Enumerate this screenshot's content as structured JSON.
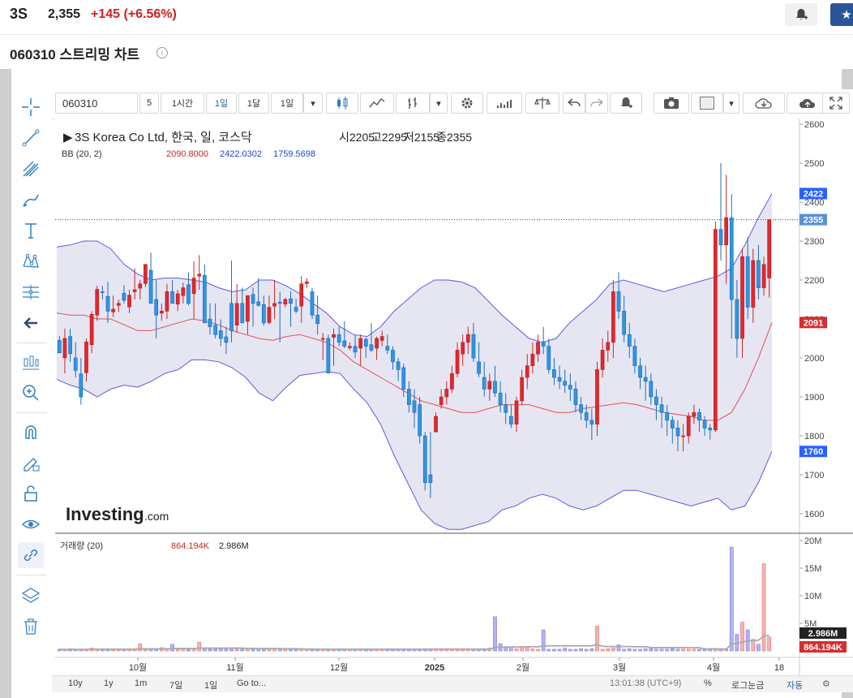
{
  "header": {
    "ticker": "3S",
    "price": "2,355",
    "change": "+145  (+6.56%)",
    "subtitle": "060310 스트리밍 차트"
  },
  "toolbar": {
    "symbol": "060310",
    "interval_num": "5",
    "interval_1h": "1시간",
    "interval_1d": "1일",
    "interval_1mo": "1달",
    "interval_dropdown": "1일"
  },
  "legend": {
    "main_title": "3S Korea Co Ltd, 한국, 일, 코스닥",
    "open": "시2205",
    "high": "고2295",
    "low": "저2155",
    "close": "종2355",
    "bb_label": "BB (20, 2)",
    "bb_mid": "2090.8000",
    "bb_upper": "2422.0302",
    "bb_lower": "1759.5698",
    "vol_label": "거래량 (20)",
    "vol_val1": "864.194K",
    "vol_val2": "2.986M"
  },
  "watermark": {
    "brand": "Investing",
    "suffix": ".com"
  },
  "chart_data": {
    "type": "candlestick",
    "price_axis": {
      "min": 1600,
      "max": 2600,
      "ticks": [
        1600,
        1700,
        1800,
        1900,
        2000,
        2100,
        2200,
        2300,
        2400,
        2500,
        2600
      ]
    },
    "price_badges": [
      {
        "label": "2422",
        "value": 2422,
        "color": "#2962ff"
      },
      {
        "label": "2355",
        "value": 2355,
        "color": "#5b8fd6"
      },
      {
        "label": "2091",
        "value": 2091,
        "color": "#d32f2f"
      },
      {
        "label": "1760",
        "value": 1760,
        "color": "#2962ff"
      }
    ],
    "volume_axis": {
      "min": 0,
      "max": 20000000,
      "tick_labels": [
        "5M",
        "10M",
        "15M",
        "20M"
      ]
    },
    "volume_badges": [
      {
        "label": "2.986M",
        "color": "#222"
      },
      {
        "label": "864.194K",
        "color": "#d32f2f"
      }
    ],
    "x_labels": [
      "10월",
      "11월",
      "12월",
      "2025",
      "2월",
      "3월",
      "4월",
      "18"
    ],
    "candles": [
      [
        2045,
        2056,
        2015,
        2013
      ],
      [
        2000,
        2075,
        1960,
        2050
      ],
      [
        2055,
        2075,
        1990,
        2011
      ],
      [
        2000,
        2040,
        1950,
        1968
      ],
      [
        1959,
        2000,
        1880,
        1900
      ],
      [
        1962,
        2050,
        1940,
        2041
      ],
      [
        2034,
        2120,
        2012,
        2112
      ],
      [
        2110,
        2185,
        2095,
        2176
      ],
      [
        2170,
        2185,
        2150,
        2168
      ],
      [
        2158,
        2196,
        2090,
        2120
      ],
      [
        2118,
        2160,
        2105,
        2125
      ],
      [
        2135,
        2150,
        2118,
        2140
      ],
      [
        2166,
        2187,
        2140,
        2148
      ],
      [
        2131,
        2175,
        2115,
        2161
      ],
      [
        2170,
        2230,
        2150,
        2175
      ],
      [
        2179,
        2200,
        2150,
        2190
      ],
      [
        2191,
        2241,
        2182,
        2240
      ],
      [
        2225,
        2270,
        2160,
        2140
      ],
      [
        2150,
        2200,
        2050,
        2110
      ],
      [
        2115,
        2140,
        2095,
        2120
      ],
      [
        2120,
        2190,
        2100,
        2170
      ],
      [
        2170,
        2200,
        2150,
        2140
      ],
      [
        2138,
        2175,
        2120,
        2165
      ],
      [
        2160,
        2193,
        2140,
        2180
      ],
      [
        2188,
        2220,
        2135,
        2140
      ],
      [
        2165,
        2248,
        2100,
        2205
      ],
      [
        2210,
        2264,
        2175,
        2215
      ],
      [
        2212,
        2240,
        2095,
        2090
      ],
      [
        2100,
        2140,
        2060,
        2080
      ],
      [
        2084,
        2140,
        2050,
        2060
      ],
      [
        2070,
        2099,
        2030,
        2050
      ],
      [
        2054,
        2080,
        2010,
        2040
      ],
      [
        2140,
        2250,
        2040,
        2070
      ],
      [
        2084,
        2190,
        2065,
        2140
      ],
      [
        2140,
        2180,
        2090,
        2090
      ],
      [
        2094,
        2160,
        2060,
        2160
      ],
      [
        2163,
        2181,
        2080,
        2140
      ],
      [
        2144,
        2205,
        2132,
        2135
      ],
      [
        2137,
        2160,
        2083,
        2090
      ],
      [
        2091,
        2160,
        2086,
        2130
      ],
      [
        2133,
        2200,
        2100,
        2140
      ],
      [
        2143,
        2170,
        2040,
        2140
      ],
      [
        2138,
        2155,
        2130,
        2150
      ],
      [
        2152,
        2171,
        2080,
        2140
      ],
      [
        2130,
        2152,
        2115,
        2120
      ],
      [
        2133,
        2210,
        2090,
        2190
      ],
      [
        2191,
        2205,
        2180,
        2195
      ],
      [
        2170,
        2180,
        2100,
        2110
      ],
      [
        2110,
        2160,
        2060,
        2088
      ],
      [
        2050,
        2064,
        1995,
        2050
      ],
      [
        2050,
        2060,
        1960,
        1961
      ],
      [
        2053,
        2075,
        1980,
        2060
      ],
      [
        2060,
        2080,
        2030,
        2040
      ],
      [
        2044,
        2094,
        2025,
        2030
      ],
      [
        2026,
        2040,
        2020,
        2030
      ],
      [
        2030,
        2060,
        2000,
        2015
      ],
      [
        2025,
        2060,
        1980,
        2050
      ],
      [
        2048,
        2052,
        2000,
        2030
      ],
      [
        2034,
        2089,
        2015,
        2020
      ],
      [
        2025,
        2055,
        1995,
        2050
      ],
      [
        2045,
        2070,
        2030,
        2055
      ],
      [
        2030,
        2060,
        2010,
        2020
      ],
      [
        2020,
        2030,
        1970,
        1990
      ],
      [
        1990,
        2000,
        1940,
        1970
      ],
      [
        1975,
        1985,
        1900,
        1920
      ],
      [
        1920,
        1940,
        1860,
        1880
      ],
      [
        1890,
        1920,
        1820,
        1860
      ],
      [
        1880,
        1900,
        1780,
        1800
      ],
      [
        1800,
        1810,
        1660,
        1680
      ],
      [
        1700,
        1810,
        1640,
        1680
      ],
      [
        1810,
        1860,
        1810,
        1850
      ],
      [
        1880,
        1920,
        1870,
        1900
      ],
      [
        1900,
        1940,
        1880,
        1920
      ],
      [
        1920,
        1980,
        1910,
        1960
      ],
      [
        1960,
        2040,
        1950,
        2020
      ],
      [
        2010,
        2060,
        1980,
        2040
      ],
      [
        2040,
        2080,
        2010,
        2060
      ],
      [
        2060,
        2090,
        1990,
        2000
      ],
      [
        1990,
        2040,
        1950,
        1960
      ],
      [
        1950,
        1990,
        1900,
        1920
      ],
      [
        1920,
        1960,
        1890,
        1940
      ],
      [
        1940,
        1980,
        1900,
        1910
      ],
      [
        1910,
        1940,
        1860,
        1880
      ],
      [
        1880,
        1910,
        1830,
        1860
      ],
      [
        1850,
        1880,
        1820,
        1830
      ],
      [
        1830,
        1900,
        1810,
        1890
      ],
      [
        1890,
        1970,
        1880,
        1950
      ],
      [
        1950,
        2010,
        1920,
        1980
      ],
      [
        1980,
        2040,
        1960,
        2010
      ],
      [
        2010,
        2060,
        1990,
        2040
      ],
      [
        2040,
        2080,
        2010,
        2030
      ],
      [
        2030,
        2050,
        1960,
        1970
      ],
      [
        1970,
        2000,
        1930,
        1950
      ],
      [
        1950,
        1980,
        1920,
        1940
      ],
      [
        1940,
        1970,
        1910,
        1930
      ],
      [
        1930,
        1960,
        1890,
        1920
      ],
      [
        1920,
        1940,
        1860,
        1880
      ],
      [
        1880,
        1900,
        1840,
        1860
      ],
      [
        1860,
        1880,
        1820,
        1840
      ],
      [
        1840,
        1870,
        1790,
        1830
      ],
      [
        1830,
        1990,
        1800,
        1970
      ],
      [
        1970,
        2050,
        1950,
        2020
      ],
      [
        2020,
        2070,
        1990,
        2040
      ],
      [
        2040,
        2200,
        2000,
        2170
      ],
      [
        2170,
        2220,
        2100,
        2120
      ],
      [
        2120,
        2160,
        2040,
        2060
      ],
      [
        2060,
        2090,
        2000,
        2030
      ],
      [
        2030,
        2050,
        1960,
        1980
      ],
      [
        1980,
        2000,
        1920,
        1950
      ],
      [
        1950,
        1980,
        1890,
        1940
      ],
      [
        1940,
        1960,
        1880,
        1900
      ],
      [
        1900,
        1920,
        1840,
        1880
      ],
      [
        1880,
        1900,
        1820,
        1860
      ],
      [
        1860,
        1880,
        1800,
        1840
      ],
      [
        1840,
        1850,
        1780,
        1820
      ],
      [
        1820,
        1840,
        1760,
        1800
      ],
      [
        1800,
        1830,
        1760,
        1800
      ],
      [
        1800,
        1860,
        1780,
        1850
      ],
      [
        1850,
        1880,
        1830,
        1860
      ],
      [
        1860,
        1870,
        1810,
        1840
      ],
      [
        1840,
        1850,
        1800,
        1820
      ],
      [
        1820,
        1830,
        1790,
        1815
      ],
      [
        1815,
        2350,
        1810,
        2330
      ],
      [
        2330,
        2500,
        2250,
        2290
      ],
      [
        2290,
        2470,
        2190,
        2360
      ],
      [
        2360,
        2420,
        2050,
        2150
      ],
      [
        2150,
        2200,
        2000,
        2050
      ],
      [
        2050,
        2280,
        2000,
        2260
      ],
      [
        2260,
        2310,
        2100,
        2130
      ],
      [
        2130,
        2280,
        2090,
        2250
      ],
      [
        2250,
        2290,
        2150,
        2180
      ],
      [
        2180,
        2260,
        2160,
        2240
      ],
      [
        2205,
        2295,
        2155,
        2355
      ]
    ],
    "bb_upper": [
      2285,
      2290,
      2300,
      2300,
      2280,
      2240,
      2215,
      2200,
      2205,
      2205,
      2200,
      2195,
      2180,
      2170,
      2175,
      2200,
      2200,
      2185,
      2165,
      2140,
      2115,
      2080,
      2060,
      2055,
      2080,
      2120,
      2150,
      2180,
      2200,
      2200,
      2195,
      2180,
      2145,
      2110,
      2080,
      2050,
      2040,
      2050,
      2090,
      2120,
      2150,
      2190,
      2200,
      2190,
      2180,
      2170,
      2180,
      2190,
      2200,
      2210,
      2230,
      2290,
      2360,
      2422
    ],
    "bb_middle": [
      2115,
      2110,
      2110,
      2100,
      2100,
      2085,
      2070,
      2070,
      2080,
      2090,
      2100,
      2095,
      2085,
      2070,
      2060,
      2050,
      2045,
      2055,
      2060,
      2050,
      2040,
      2020,
      1990,
      1970,
      1950,
      1930,
      1910,
      1890,
      1880,
      1870,
      1860,
      1860,
      1870,
      1880,
      1880,
      1880,
      1870,
      1860,
      1860,
      1870,
      1875,
      1880,
      1885,
      1880,
      1870,
      1860,
      1855,
      1850,
      1840,
      1840,
      1860,
      1920,
      2000,
      2091
    ],
    "bb_lower": [
      1945,
      1930,
      1920,
      1900,
      1920,
      1930,
      1925,
      1940,
      1960,
      1970,
      1995,
      1995,
      1990,
      1975,
      1950,
      1910,
      1890,
      1925,
      1955,
      1960,
      1965,
      1960,
      1920,
      1885,
      1830,
      1750,
      1680,
      1610,
      1575,
      1560,
      1560,
      1570,
      1580,
      1610,
      1620,
      1640,
      1650,
      1640,
      1620,
      1610,
      1620,
      1640,
      1660,
      1660,
      1650,
      1640,
      1630,
      1620,
      1630,
      1640,
      1610,
      1620,
      1680,
      1760
    ],
    "volume_heights": [
      0.3,
      0.2,
      0.4,
      0.2,
      0.3,
      0.3,
      0.5,
      0.3,
      0.3,
      0.4,
      0.2,
      0.3,
      0.3,
      0.3,
      0.4,
      1.3,
      0.4,
      0.3,
      0.4,
      0.6,
      0.3,
      1.2,
      0.3,
      0.4,
      0.3,
      0.4,
      1.6,
      0.4,
      0.3,
      0.3,
      0.3,
      0.4,
      0.3,
      0.3,
      0.3,
      0.4,
      0.3,
      0.2,
      0.3,
      0.3,
      0.4,
      0.5,
      0.3,
      0.3,
      0.3,
      0.3,
      0.3,
      0.3,
      0.2,
      0.3,
      0.3,
      0.3,
      0.3,
      0.3,
      0.3,
      0.3,
      0.3,
      0.4,
      0.3,
      0.3,
      0.3,
      0.4,
      0.3,
      0.4,
      0.4,
      0.3,
      0.3,
      0.3,
      0.4,
      0.4,
      0.3,
      0.3,
      0.3,
      0.3,
      0.3,
      0.3,
      0.4,
      0.3,
      0.3,
      0.3,
      0.5,
      6.2,
      1.3,
      0.8,
      0.7,
      0.4,
      0.5,
      0.7,
      0.4,
      0.3,
      3.8,
      0.3,
      0.3,
      0.3,
      0.5,
      0.3,
      0.3,
      0.4,
      0.3,
      0.4,
      4.5,
      0.3,
      0.4,
      0.5,
      1.1,
      0.3,
      0.4,
      0.3,
      0.3,
      0.4,
      0.4,
      0.3,
      0.3,
      0.3,
      0.4,
      0.3,
      0.3,
      0.3,
      0.3,
      0.3,
      0.3,
      0.4,
      0.3,
      0.3,
      0.3,
      18.8,
      3.0,
      5.2,
      3.8,
      2.1,
      1.2,
      15.8,
      2.5,
      1.0,
      1.5,
      0.9
    ]
  },
  "bottombar": {
    "r10y": "10y",
    "r1y": "1y",
    "r1m": "1m",
    "r7d": "7일",
    "r1d": "1일",
    "goto": "Go to...",
    "time": "13:01:38 (UTC+9)",
    "percent": "%",
    "log": "로그눈금",
    "auto": "자동"
  }
}
